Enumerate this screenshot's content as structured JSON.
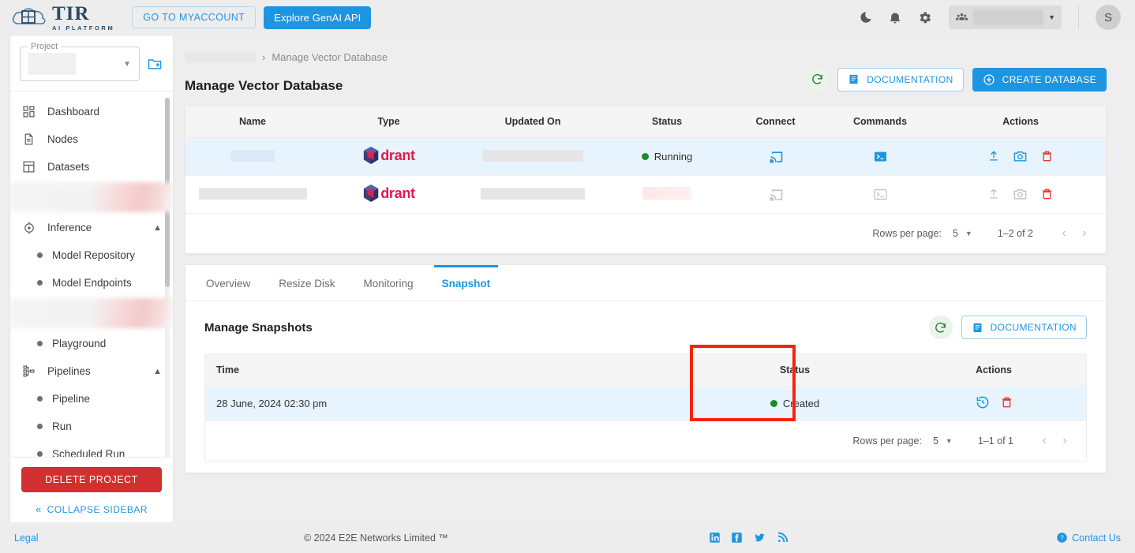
{
  "header": {
    "logo_title": "TIR",
    "logo_subtitle": "AI PLATFORM",
    "myaccount_button": "GO TO MYACCOUNT",
    "genai_button": "Explore GenAI API",
    "dark_mode_icon": "moon-icon",
    "notifications_icon": "bell-icon",
    "settings_icon": "gear-icon",
    "team_icon": "team-icon",
    "avatar_initial": "S"
  },
  "sidebar": {
    "project_label": "Project",
    "add_project_icon": "folder-add-icon",
    "items": [
      {
        "label": "Dashboard",
        "icon": "dashboard-icon",
        "type": "item"
      },
      {
        "label": "Nodes",
        "icon": "document-icon",
        "type": "item"
      },
      {
        "label": "Datasets",
        "icon": "grid-icon",
        "type": "item"
      },
      {
        "label": "",
        "icon": "",
        "type": "redacted"
      },
      {
        "label": "Inference",
        "icon": "inference-icon",
        "type": "group",
        "expanded": true
      },
      {
        "label": "Model Repository",
        "icon": "",
        "type": "sub"
      },
      {
        "label": "Model Endpoints",
        "icon": "",
        "type": "sub"
      },
      {
        "label": "",
        "icon": "",
        "type": "redacted"
      },
      {
        "label": "Playground",
        "icon": "",
        "type": "sub"
      },
      {
        "label": "Pipelines",
        "icon": "pipelines-icon",
        "type": "group",
        "expanded": true
      },
      {
        "label": "Pipeline",
        "icon": "",
        "type": "sub"
      },
      {
        "label": "Run",
        "icon": "",
        "type": "sub"
      },
      {
        "label": "Scheduled Run",
        "icon": "",
        "type": "sub"
      }
    ],
    "delete_project_button": "DELETE PROJECT",
    "collapse_label": "COLLAPSE SIDEBAR",
    "collapse_icon": "double-chevron-left-icon"
  },
  "main": {
    "breadcrumb_current": "Manage Vector Database",
    "breadcrumb_separator": "›",
    "page_title": "Manage Vector Database",
    "refresh_icon": "refresh-icon",
    "documentation_button": "DOCUMENTATION",
    "documentation_icon": "book-icon",
    "create_database_button": "CREATE DATABASE",
    "create_icon": "plus-circle-icon"
  },
  "db_table": {
    "columns": [
      "Name",
      "Type",
      "Updated On",
      "Status",
      "Connect",
      "Commands",
      "Actions"
    ],
    "rows": [
      {
        "name": "",
        "type": "drant",
        "updated_on": "",
        "status": "Running",
        "status_color": "#1b8b2b",
        "active": true,
        "enabled": true,
        "connect_icon": "cast-connect-icon",
        "commands_icon": "terminal-icon",
        "actions": [
          "upgrade-icon",
          "snapshot-camera-icon",
          "delete-icon"
        ]
      },
      {
        "name": "",
        "type": "drant",
        "updated_on": "",
        "status": "",
        "status_color": "#f3dcdc",
        "active": false,
        "enabled": false,
        "connect_icon": "cast-connect-icon",
        "commands_icon": "terminal-icon",
        "actions": [
          "upgrade-icon",
          "snapshot-camera-icon",
          "delete-icon"
        ]
      }
    ],
    "pagination": {
      "rows_per_page_label": "Rows per page:",
      "rows_per_page_value": "5",
      "range": "1–2 of 2",
      "prev_icon": "chevron-left-icon",
      "next_icon": "chevron-right-icon"
    }
  },
  "tabs": [
    {
      "label": "Overview",
      "active": false
    },
    {
      "label": "Resize Disk",
      "active": false
    },
    {
      "label": "Monitoring",
      "active": false
    },
    {
      "label": "Snapshot",
      "active": true
    }
  ],
  "snapshots": {
    "title": "Manage Snapshots",
    "refresh_icon": "refresh-icon",
    "documentation_button": "DOCUMENTATION",
    "documentation_icon": "book-icon",
    "columns": [
      "Time",
      "Status",
      "Actions"
    ],
    "rows": [
      {
        "time": "28 June, 2024 02:30 pm",
        "status": "Created",
        "status_color": "#1b8b2b",
        "actions": [
          "restore-icon",
          "delete-icon"
        ]
      }
    ],
    "pagination": {
      "rows_per_page_label": "Rows per page:",
      "rows_per_page_value": "5",
      "range": "1–1 of 1",
      "prev_icon": "chevron-left-icon",
      "next_icon": "chevron-right-icon"
    },
    "highlight_color": "#f5230c"
  },
  "footer": {
    "legal": "Legal",
    "copyright": "© 2024 E2E Networks Limited ™",
    "social": [
      "linkedin-icon",
      "facebook-icon",
      "twitter-icon",
      "rss-icon"
    ],
    "contact": "Contact Us",
    "contact_icon": "help-circle-icon"
  },
  "colors": {
    "accent": "#1e95e0",
    "danger": "#d32f2f",
    "success": "#1b8b2b",
    "highlight": "#f5230c"
  }
}
